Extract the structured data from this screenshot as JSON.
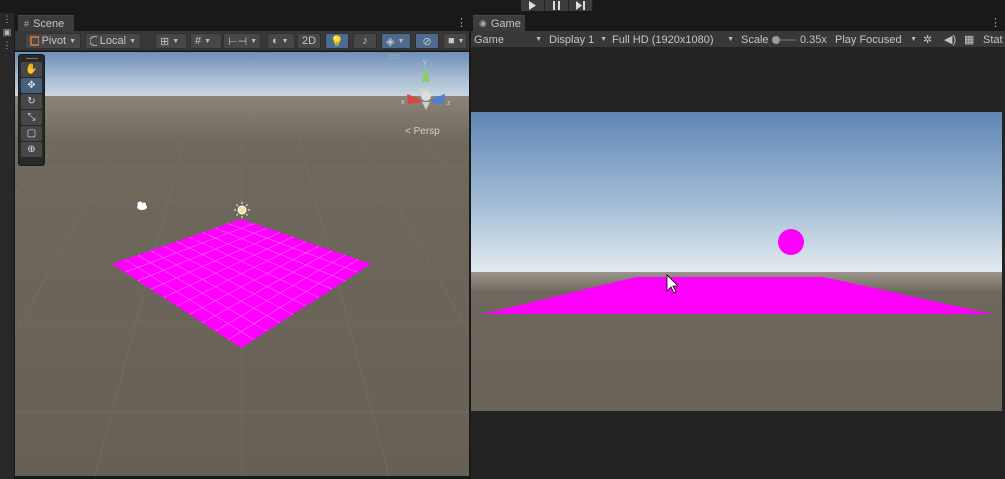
{
  "play_controls": {
    "play_icon": "play-icon",
    "pause_icon": "pause-icon",
    "step_icon": "step-icon"
  },
  "scene": {
    "tab_label": "Scene",
    "toolbar": {
      "pivot_label": "Pivot",
      "local_label": "Local",
      "mode_2d_label": "2D"
    },
    "tools": [
      "hand-icon",
      "move-icon",
      "rotate-icon",
      "scale-icon",
      "rect-icon",
      "transform-icon"
    ],
    "persp_label": "< Persp",
    "gizmo_axes": {
      "y": "y",
      "x": "x",
      "z": "z"
    }
  },
  "game": {
    "tab_label": "Game",
    "toolbar": {
      "mode_label": "Game",
      "display_label": "Display 1",
      "resolution_label": "Full HD (1920x1080)",
      "scale_label": "Scale",
      "scale_value": "0.35x",
      "play_focus_label": "Play Focused",
      "stats_label": "Stat"
    }
  },
  "colors": {
    "magenta": "#ff00ff",
    "editor_dark": "#191919",
    "panel": "#383838",
    "scene_ground": "#6b6458",
    "sky_top": "#5e86b5"
  }
}
